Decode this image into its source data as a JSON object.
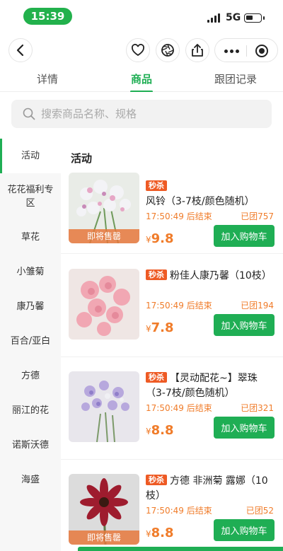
{
  "status_bar": {
    "time": "15:39",
    "network": "5G"
  },
  "tabs": [
    {
      "label": "详情",
      "active": false
    },
    {
      "label": "商品",
      "active": true
    },
    {
      "label": "跟团记录",
      "active": false
    }
  ],
  "search": {
    "placeholder": "搜索商品名称、规格"
  },
  "sidebar": {
    "items": [
      {
        "label": "活动",
        "active": true
      },
      {
        "label": "花花福利专区"
      },
      {
        "label": "草花"
      },
      {
        "label": "小雏菊"
      },
      {
        "label": "康乃馨"
      },
      {
        "label": "百合/亚白"
      },
      {
        "label": "方德"
      },
      {
        "label": "丽江的花"
      },
      {
        "label": "诺斯沃德"
      },
      {
        "label": "海盛"
      }
    ]
  },
  "section_title": "活动",
  "products": [
    {
      "badge": "秒杀",
      "title": "风铃（3-7枝/颜色随机）",
      "countdown": "17:50:49 后结束",
      "group_count": "已团757",
      "currency": "¥",
      "price": "9.8",
      "overlay": "即将售罄",
      "cart_label": "加入购物车"
    },
    {
      "badge": "秒杀",
      "title": "粉佳人康乃馨（10枝）",
      "countdown": "17:50:49 后结束",
      "group_count": "已团194",
      "currency": "¥",
      "price": "7.8",
      "overlay": "",
      "cart_label": "加入购物车"
    },
    {
      "badge": "秒杀",
      "title": "【灵动配花~】翠珠（3-7枝/颜色随机）",
      "countdown": "17:50:49 后结束",
      "group_count": "已团321",
      "currency": "¥",
      "price": "8.8",
      "overlay": "",
      "cart_label": "加入购物车"
    },
    {
      "badge": "秒杀",
      "title": "方德 非洲菊 露娜（10枝）",
      "countdown": "17:50:49 后结束",
      "group_count": "已团52",
      "currency": "¥",
      "price": "8.8",
      "overlay": "即将售罄",
      "cart_label": "加入购物车"
    }
  ],
  "colors": {
    "accent": "#1fae54",
    "orange": "#f07c2a",
    "badge": "#ee5a24"
  },
  "icons": [
    "back-icon",
    "favorite-icon",
    "aperture-icon",
    "share-icon",
    "more-icon",
    "target-icon",
    "search-icon"
  ]
}
